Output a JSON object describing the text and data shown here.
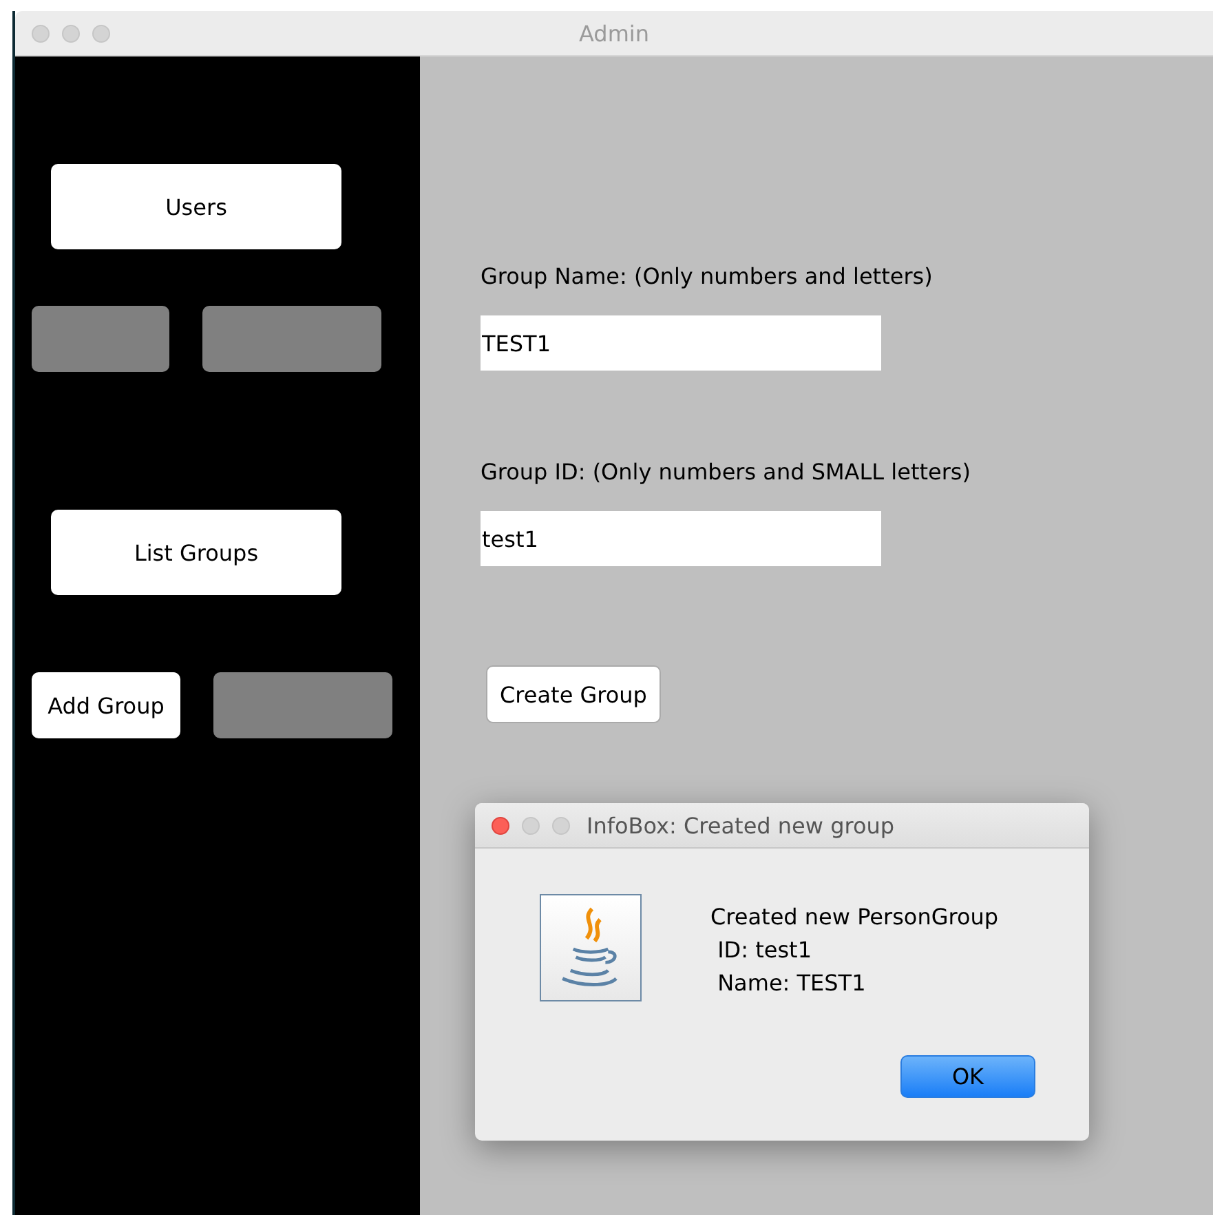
{
  "window": {
    "title": "Admin"
  },
  "sidebar": {
    "rows": [
      {
        "buttons": [
          {
            "kind": "wide",
            "label": "Users"
          }
        ]
      },
      {
        "buttons": [
          {
            "kind": "blank"
          },
          {
            "kind": "blank"
          }
        ]
      },
      {
        "buttons": [
          {
            "kind": "wide",
            "label": "List Groups"
          }
        ]
      },
      {
        "buttons": [
          {
            "kind": "small",
            "label": "Add Group"
          },
          {
            "kind": "blank"
          }
        ]
      }
    ]
  },
  "form": {
    "fields": [
      {
        "label": "Group Name: (Only numbers and letters)",
        "value": "TEST1"
      },
      {
        "label": "Group ID: (Only numbers and SMALL letters)",
        "value": "test1"
      }
    ],
    "button": "Create Group"
  },
  "dialog": {
    "title": "InfoBox: Created new group",
    "lines": [
      "Created new PersonGroup",
      " ID: test1",
      " Name: TEST1"
    ],
    "button": "OK"
  }
}
